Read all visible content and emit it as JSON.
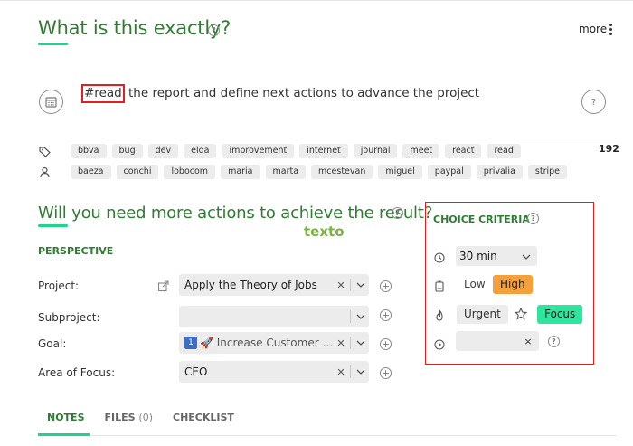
{
  "header": {
    "title": "What is this exactly?",
    "more_label": "more"
  },
  "action": {
    "hashtag": "#read",
    "text": " the report and define next actions to advance the project"
  },
  "tags": [
    "bbva",
    "bug",
    "dev",
    "elda",
    "improvement",
    "internet",
    "journal",
    "meet",
    "react",
    "read"
  ],
  "people": [
    "baeza",
    "conchi",
    "lobocom",
    "maria",
    "marta",
    "mcestevan",
    "miguel",
    "paypal",
    "privalia",
    "stripe"
  ],
  "count": "192",
  "section": {
    "title": "Will you need more actions to achieve the result?",
    "texto": "texto",
    "perspective": "PERSPECTIVE"
  },
  "fields": {
    "project": {
      "label": "Project:",
      "value": "Apply the Theory of Jobs"
    },
    "subproject": {
      "label": "Subproject:",
      "value": ""
    },
    "goal": {
      "label": "Goal:",
      "badge": "1",
      "value": "🚀 Increase Customer Acq..."
    },
    "area": {
      "label": "Area of Focus:",
      "value": "CEO"
    }
  },
  "criteria": {
    "title": "CHOICE CRITERIA",
    "time": "30 min",
    "low": "Low",
    "high": "High",
    "urgent": "Urgent",
    "focus": "Focus",
    "clear": "×"
  },
  "tabs": {
    "notes": "NOTES",
    "files": "FILES",
    "files_count": "(0)",
    "checklist": "CHECKLIST"
  },
  "colors": {
    "green_text": "#2e7d32",
    "accent": "#1fd48a",
    "highlight_red": "#e02020",
    "high_orange": "#f5a03a",
    "focus_green": "#2ee59d",
    "texto_green": "#7cb342"
  }
}
